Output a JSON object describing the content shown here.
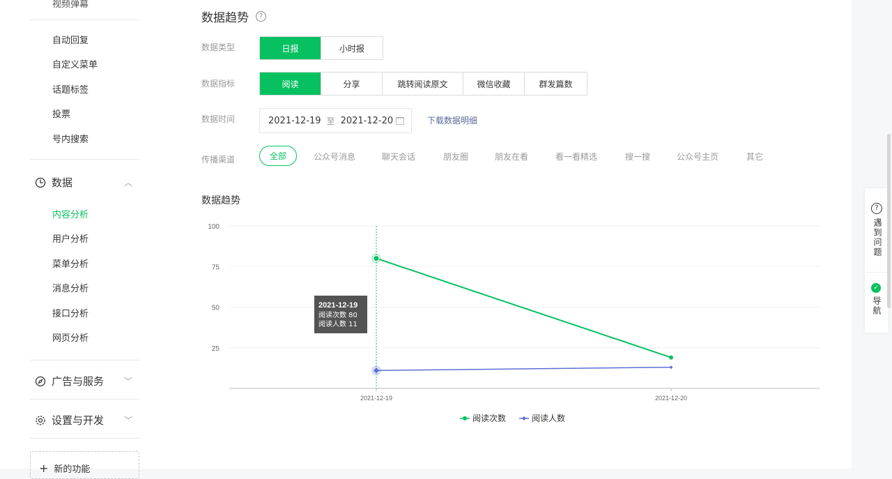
{
  "sidebar": {
    "top_cut_item": "视频弹幕",
    "items_top": [
      "自动回复",
      "自定义菜单",
      "话题标签",
      "投票",
      "号内搜索"
    ],
    "group_data": "数据",
    "items_data": [
      "内容分析",
      "用户分析",
      "菜单分析",
      "消息分析",
      "接口分析",
      "网页分析"
    ],
    "group_ads": "广告与服务",
    "group_settings": "设置与开发",
    "new_function": "新的功能"
  },
  "main": {
    "page_title": "数据趋势",
    "data_type_label": "数据类型",
    "data_type_options": [
      "日报",
      "小时报"
    ],
    "metric_label": "数据指标",
    "metric_options": [
      "阅读",
      "分享",
      "跳转阅读原文",
      "微信收藏",
      "群发篇数"
    ],
    "time_label": "数据时间",
    "date_start": "2021-12-19",
    "date_sep": "至",
    "date_end": "2021-12-20",
    "download_link": "下载数据明细",
    "channel_label": "传播渠道",
    "channels": [
      "全部",
      "公众号消息",
      "聊天会话",
      "朋友圈",
      "朋友在看",
      "看一看精选",
      "搜一搜",
      "公众号主页",
      "其它"
    ],
    "chart_section_title": "数据趋势"
  },
  "tooltip": {
    "date": "2021-12-19",
    "line1": "阅读次数 80",
    "line2": "阅读人数 11"
  },
  "right_rail": {
    "help": "遇到问题",
    "nav": "导航"
  },
  "colors": {
    "accent": "#07c160",
    "series2": "#5b6fd3",
    "link": "#576b95"
  },
  "chart_data": {
    "type": "line",
    "x": [
      "2021-12-19",
      "2021-12-20"
    ],
    "ylim": [
      0,
      100
    ],
    "yticks": [
      25,
      50,
      75,
      100
    ],
    "series": [
      {
        "name": "阅读次数",
        "values": [
          80,
          19
        ],
        "color": "#07c160"
      },
      {
        "name": "阅读人数",
        "values": [
          11,
          13
        ],
        "color": "#5b6fd3"
      }
    ],
    "legend_position": "bottom"
  }
}
